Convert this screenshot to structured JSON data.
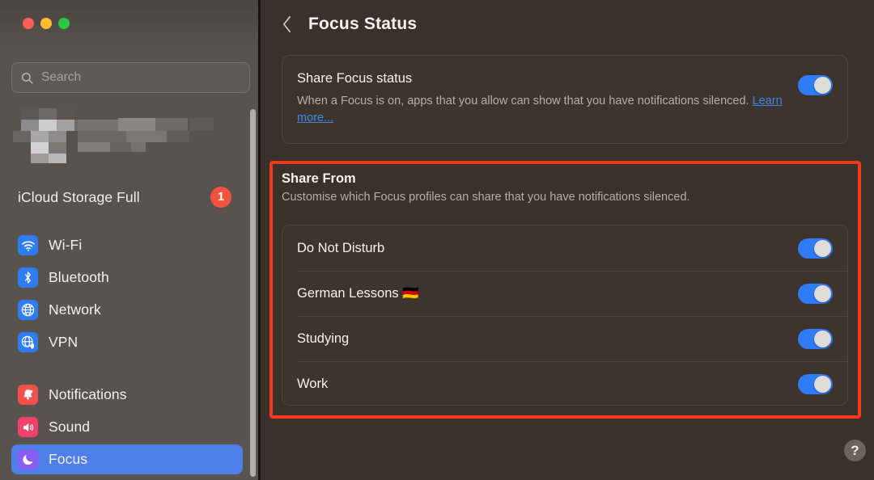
{
  "window": {
    "traffic_lights": [
      "close",
      "minimize",
      "maximize"
    ],
    "colors": {
      "close": "#ff5f57",
      "minimize": "#febc2e",
      "maximize": "#28c840",
      "sidebar_bg": "#58534f",
      "main_bg": "#3a302c",
      "card_bg": "#3e342f",
      "accent_blue": "#2f7cf6",
      "selection_blue": "#4f7fe8",
      "badge_red": "#f4523c",
      "highlight_red": "#f5391a",
      "link_blue": "#3d87e8"
    }
  },
  "sidebar": {
    "search": {
      "placeholder": "Search",
      "value": "",
      "icon": "search-icon"
    },
    "profile": {
      "obscured": true,
      "note": ""
    },
    "icloud": {
      "label": "iCloud Storage Full",
      "badge": "1"
    },
    "groups": [
      {
        "items": [
          {
            "label": "Wi-Fi",
            "icon": "wifi-icon",
            "icon_bg": "#2f7cf6",
            "selected": false
          },
          {
            "label": "Bluetooth",
            "icon": "bluetooth-icon",
            "icon_bg": "#2f7cf6",
            "selected": false
          },
          {
            "label": "Network",
            "icon": "globe-icon",
            "icon_bg": "#2f7cf6",
            "selected": false
          },
          {
            "label": "VPN",
            "icon": "globe-shield-icon",
            "icon_bg": "#2f7cf6",
            "selected": false
          }
        ]
      },
      {
        "items": [
          {
            "label": "Notifications",
            "icon": "bell-icon",
            "icon_bg": "#f0514a",
            "selected": false
          },
          {
            "label": "Sound",
            "icon": "speaker-icon",
            "icon_bg": "#f2416b",
            "selected": false
          },
          {
            "label": "Focus",
            "icon": "moon-icon",
            "icon_bg": "#8a5cf0",
            "selected": true
          }
        ]
      }
    ]
  },
  "main": {
    "header": {
      "back_icon": "chevron-left-icon",
      "title": "Focus Status"
    },
    "share_focus_status": {
      "title": "Share Focus status",
      "description_before_link": "When a Focus is on, apps that you allow can show that you have notifications silenced. ",
      "link_text": "Learn more...",
      "toggle_on": true
    },
    "share_from": {
      "heading": "Share From",
      "subtitle": "Customise which Focus profiles can share that you have notifications silenced.",
      "rows": [
        {
          "label": "Do Not Disturb",
          "toggle_on": true
        },
        {
          "label": "German Lessons 🇩🇪",
          "toggle_on": true
        },
        {
          "label": "Studying",
          "toggle_on": true
        },
        {
          "label": "Work",
          "toggle_on": true
        }
      ]
    },
    "help_button": "?"
  }
}
